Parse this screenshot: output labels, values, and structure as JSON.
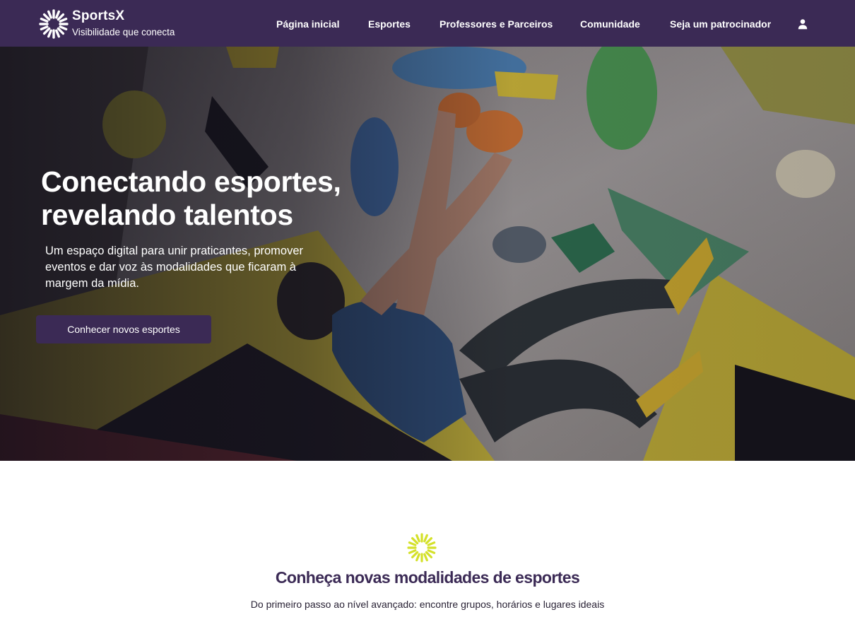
{
  "brand": {
    "name": "SportsX",
    "tagline": "Visibilidade que conecta",
    "logo_icon": "sunburst-logo-icon"
  },
  "nav": {
    "items": [
      {
        "label": "Página inicial"
      },
      {
        "label": "Esportes"
      },
      {
        "label": "Professores e Parceiros"
      },
      {
        "label": "Comunidade"
      },
      {
        "label": "Seja um patrocinador"
      }
    ],
    "user_icon": "user-icon"
  },
  "hero": {
    "title": "Conectando esportes, revelando talentos",
    "subtitle": "Um espaço digital para unir praticantes, promover eventos e dar voz às modalidades que ficaram à margem da mídia.",
    "cta_label": "Conhecer novos esportes",
    "image": "climbing-wall-photo"
  },
  "section": {
    "icon": "sunburst-icon",
    "title": "Conheça novas modalidades de esportes",
    "description": "Do primeiro passo ao nível avançado: encontre grupos, horários e lugares ideais"
  },
  "colors": {
    "primary": "#3b2a55",
    "accent": "#d4e12a",
    "text_dark": "#2a2336",
    "white": "#ffffff"
  }
}
